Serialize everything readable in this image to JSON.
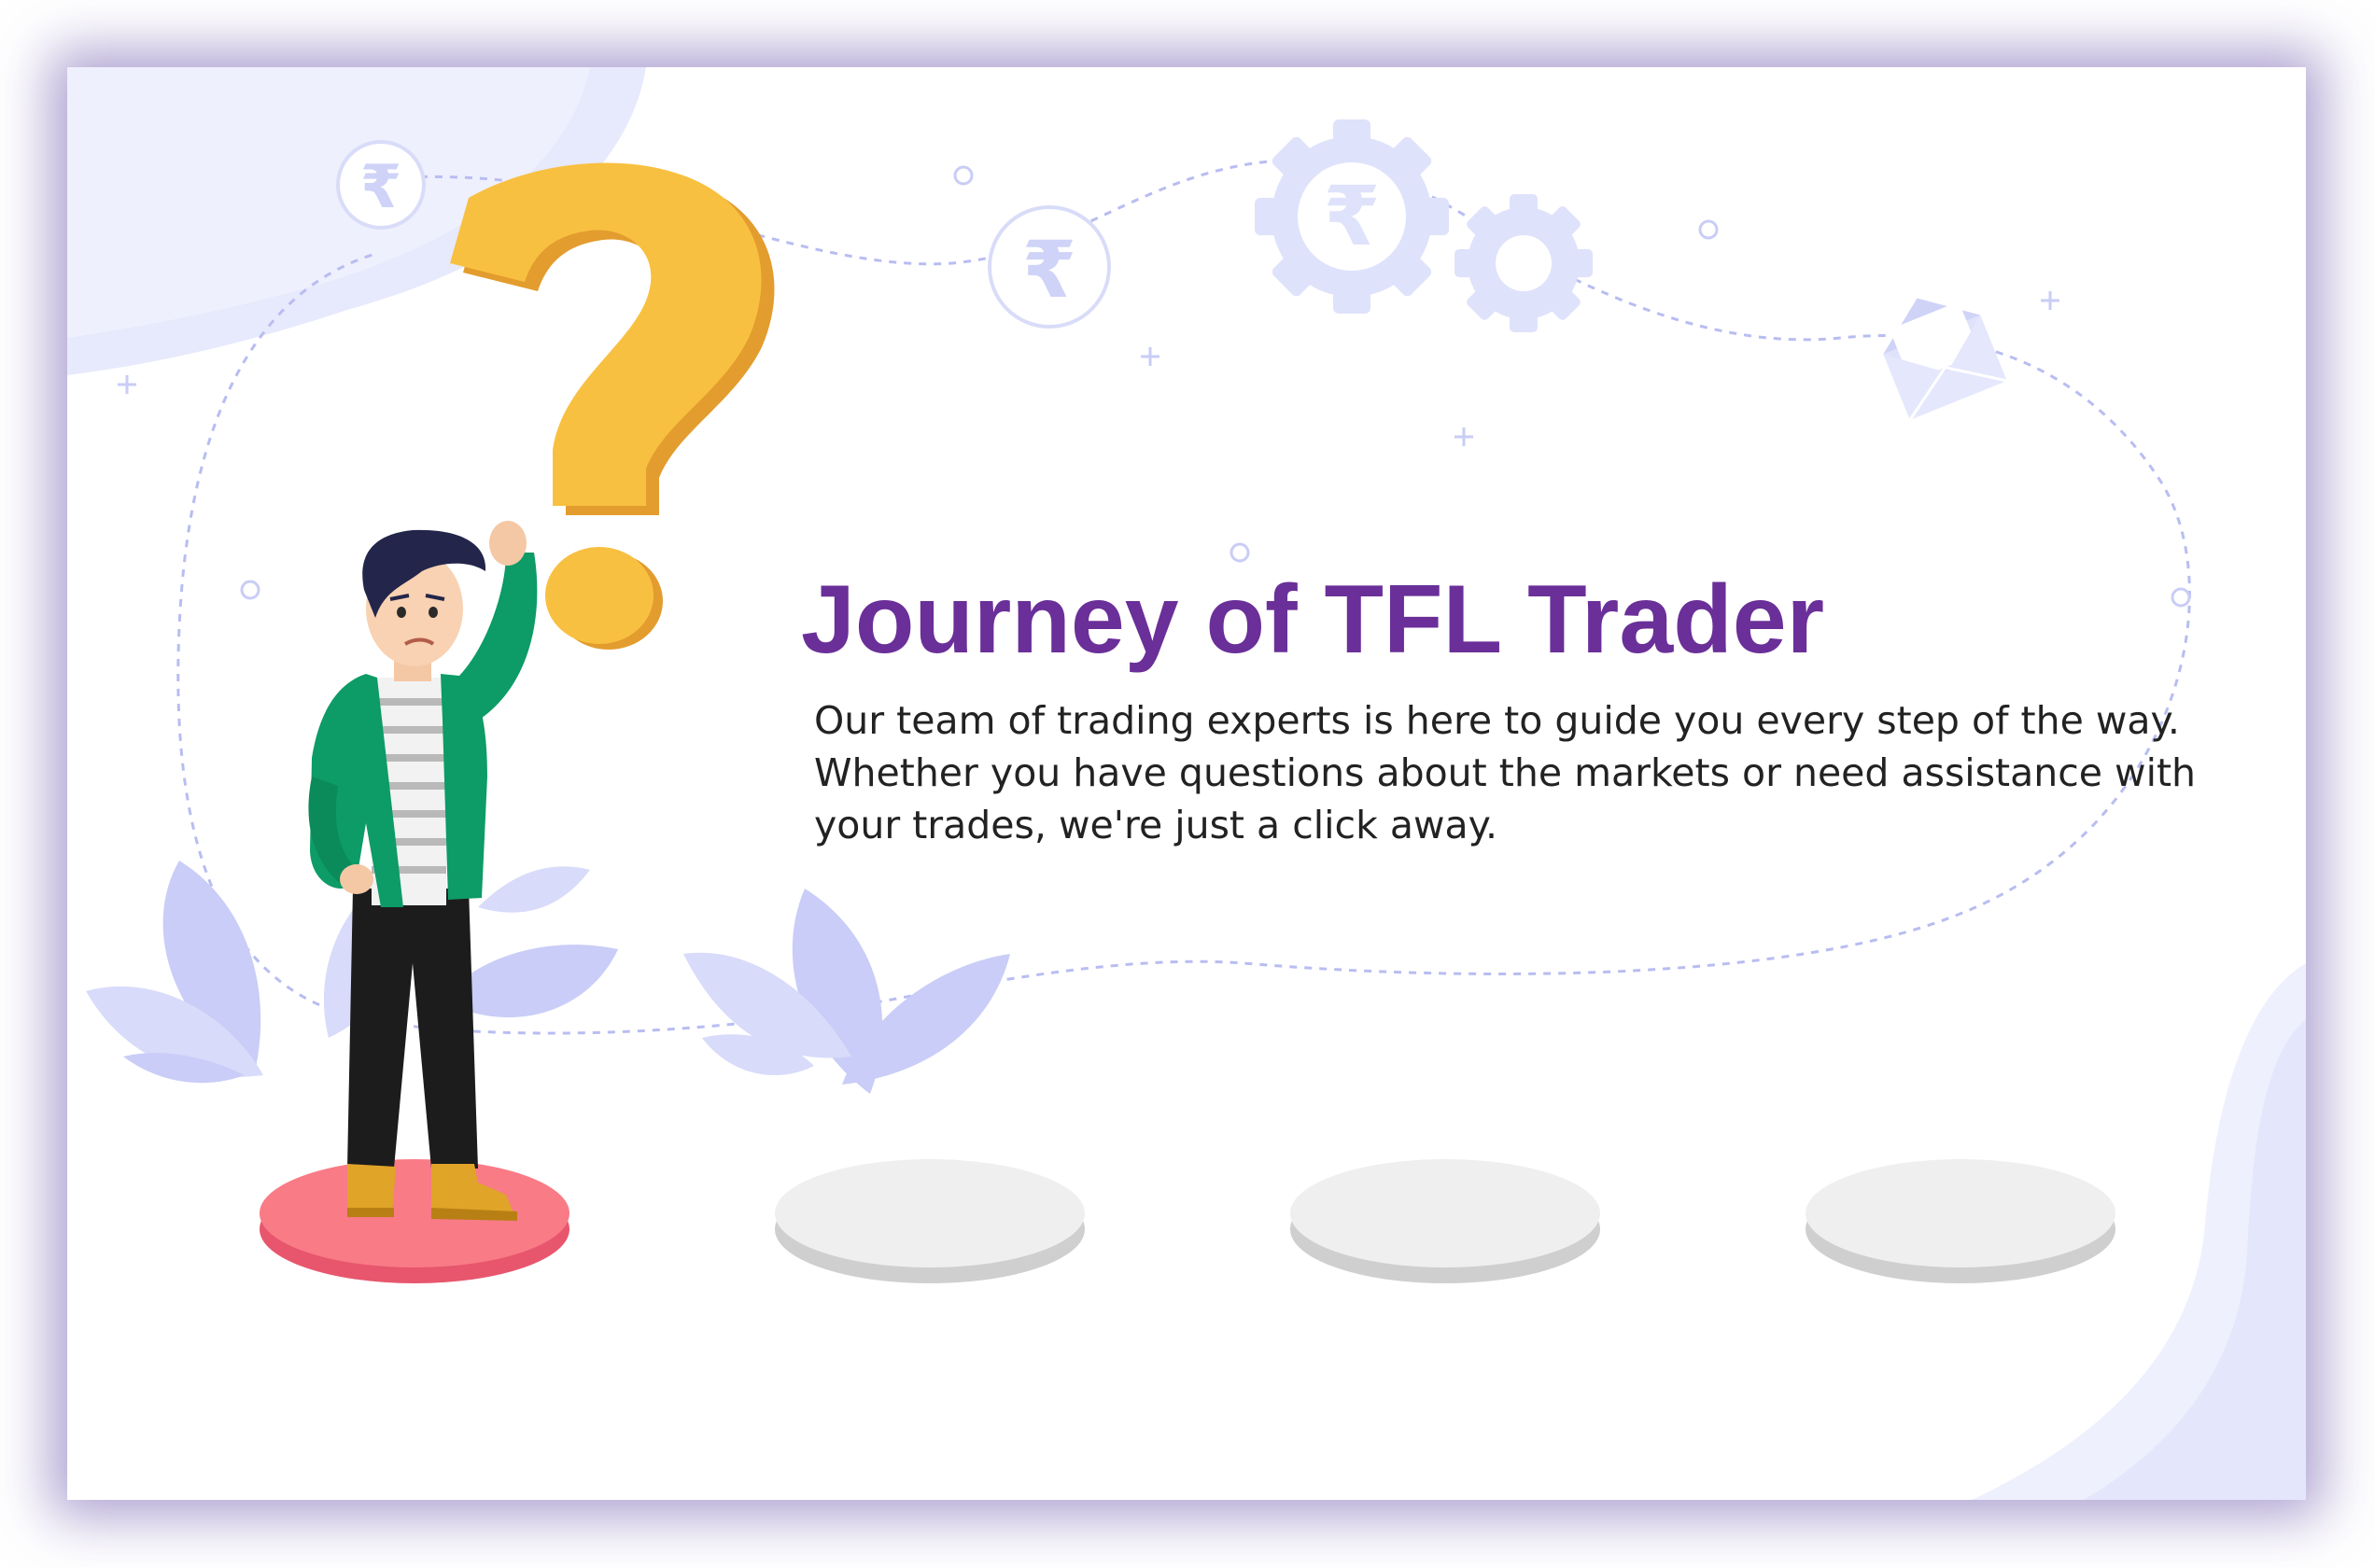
{
  "hero": {
    "title": "Journey of TFL Trader",
    "description": "Our team of trading experts is here to guide you every step of the way. Whether you have questions about the markets or need assistance with your trades, we're just a click away."
  },
  "icons": {
    "rupee_symbol": "₹",
    "decor": [
      "rupee-coin-icon",
      "gear-icon",
      "envelope-icon",
      "question-mark-icon",
      "leaf-icon",
      "sparkle-icon"
    ]
  },
  "journey": {
    "stages": [
      {
        "state": "active",
        "color": "#f87b86"
      },
      {
        "state": "inactive",
        "color": "#efefef"
      },
      {
        "state": "inactive",
        "color": "#efefef"
      },
      {
        "state": "inactive",
        "color": "#efefef"
      }
    ]
  },
  "colors": {
    "title": "#6a2f98",
    "accent_light": "#e3e6fb",
    "question_mark": "#f8c040",
    "jacket": "#0d9b67"
  }
}
